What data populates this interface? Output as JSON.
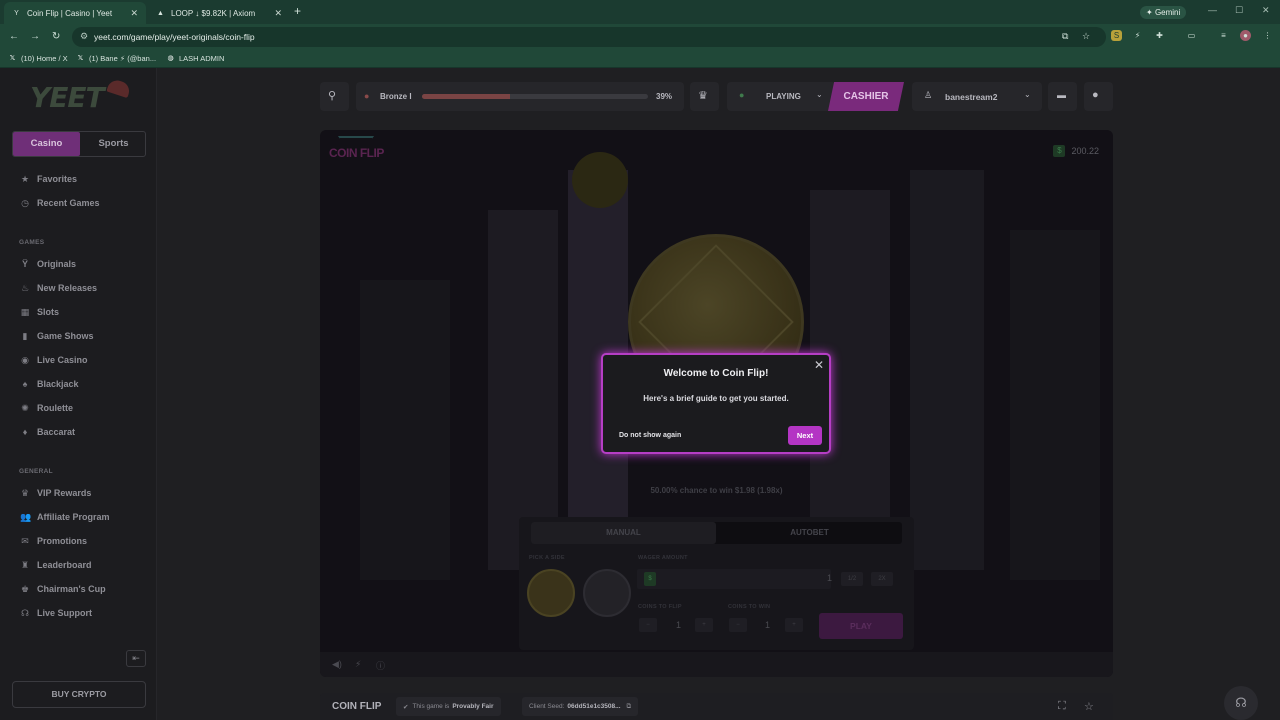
{
  "browser": {
    "tabs": [
      {
        "title": "Coin Flip | Casino | Yeet",
        "active": true
      },
      {
        "title": "LOOP ↓ $9.82K | Axiom",
        "active": false
      }
    ],
    "gemini_label": "Gemini",
    "url": "yeet.com/game/play/yeet-originals/coin-flip",
    "bookmarks": [
      "(10) Home / X",
      "(1) Bane ⚡ (@ban...",
      "LASH ADMIN"
    ]
  },
  "sidebar": {
    "logo": "YEET",
    "segments": {
      "casino": "Casino",
      "sports": "Sports"
    },
    "top_items": [
      "Favorites",
      "Recent Games"
    ],
    "games_header": "GAMES",
    "games_items": [
      "Originals",
      "New Releases",
      "Slots",
      "Game Shows",
      "Live Casino",
      "Blackjack",
      "Roulette",
      "Baccarat"
    ],
    "general_header": "GENERAL",
    "general_items": [
      "VIP Rewards",
      "Affiliate Program",
      "Promotions",
      "Leaderboard",
      "Chairman's Cup",
      "Live Support"
    ],
    "buy_crypto": "BUY CRYPTO"
  },
  "topbar": {
    "rank": "Bronze I",
    "progress_label": "39%",
    "progress_value": 0.39,
    "playing": "PLAYING",
    "cashier": "CASHIER",
    "username": "banestream2"
  },
  "game": {
    "logo": "COIN FLIP",
    "balance": "200.22",
    "chance_text": "50.00% chance to win $1.98 (1.98x)",
    "tabs": {
      "manual": "MANUAL",
      "autobet": "AUTOBET"
    },
    "pick_side": "PICK A SIDE",
    "wager_amount": "WAGER AMOUNT",
    "wager_value": "1",
    "half": "1/2",
    "double": "2X",
    "coins_to_flip": "COINS TO FLIP",
    "coins_to_flip_value": "1",
    "coins_to_win": "COINS TO WIN",
    "coins_to_win_value": "1",
    "play": "PLAY"
  },
  "modal": {
    "title": "Welcome to Coin Flip!",
    "subtitle": "Here's a brief guide to get you started.",
    "dont_show": "Do not show again",
    "next": "Next"
  },
  "infobar": {
    "title": "COIN FLIP",
    "provably_prefix": "This game is",
    "provably_fair": "Provably Fair",
    "client_seed_label": "Client Seed:",
    "client_seed_value": "06dd51e1c3508..."
  },
  "colors": {
    "accent": "#b435c4",
    "modal_border": "#b63ec5"
  }
}
